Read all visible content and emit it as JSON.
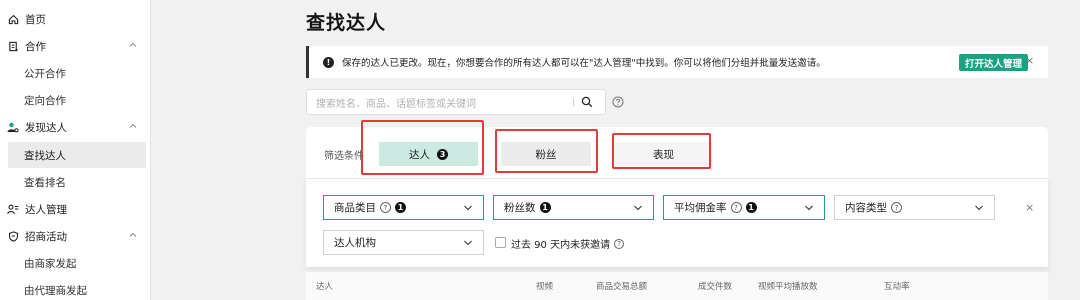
{
  "sidebar": {
    "items": [
      {
        "label": "首页",
        "icon": "home-icon"
      },
      {
        "label": "合作",
        "icon": "cooperate-icon",
        "expanded": true
      },
      {
        "label": "公开合作"
      },
      {
        "label": "定向合作"
      },
      {
        "label": "发现达人",
        "icon": "discover-talent-icon",
        "expanded": true
      },
      {
        "label": "查找达人",
        "active": true
      },
      {
        "label": "查看排名"
      },
      {
        "label": "达人管理",
        "icon": "talent-manage-icon"
      },
      {
        "label": "招商活动",
        "icon": "shield-icon",
        "expanded": true
      },
      {
        "label": "由商家发起"
      },
      {
        "label": "由代理商发起"
      }
    ]
  },
  "page": {
    "title": "查找达人"
  },
  "banner": {
    "text": "保存的达人已更改。现在，你想要合作的所有达人都可以在\"达人管理\"中找到。你可以将他们分组并批量发送邀请。",
    "button_label": "打开达人管理",
    "close": "×"
  },
  "search": {
    "placeholder": "搜索姓名、商品、话题标签或关键词"
  },
  "filters": {
    "label": "筛选条件",
    "tabs": [
      {
        "label": "达人",
        "badge": "3",
        "active": true
      },
      {
        "label": "粉丝"
      },
      {
        "label": "表现"
      }
    ],
    "dropdowns": [
      {
        "label": "商品类目",
        "has_help": true,
        "badge": "1",
        "selected": true
      },
      {
        "label": "粉丝数",
        "badge": "1",
        "selected": true
      },
      {
        "label": "平均佣金率",
        "has_help": true,
        "badge": "1",
        "selected": true
      },
      {
        "label": "内容类型",
        "has_help": true
      },
      {
        "label": "达人机构"
      }
    ],
    "checkbox_label": "过去 90 天内未获邀请",
    "close": "×"
  },
  "table": {
    "headers": [
      "达人",
      "视频",
      "商品交易总额",
      "成交件数",
      "视频平均播放数",
      "互动率"
    ]
  },
  "colors": {
    "accent": "#1aa383",
    "highlight": "#e23b3b",
    "active_tab_bg": "#cdeae2"
  }
}
